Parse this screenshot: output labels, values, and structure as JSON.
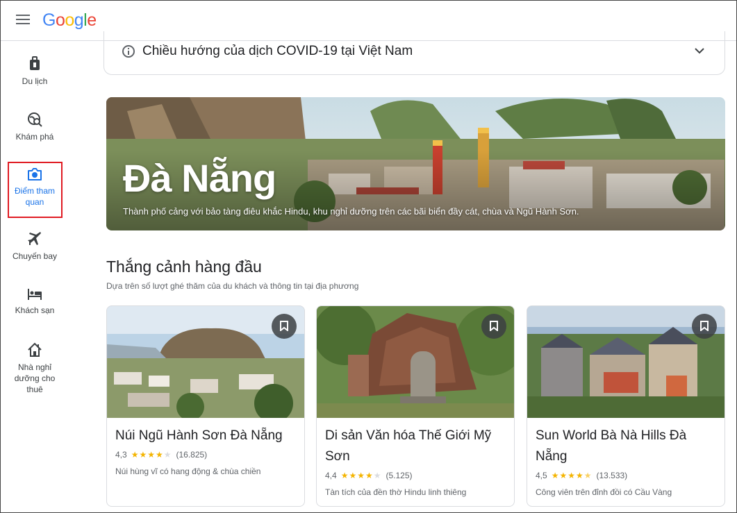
{
  "header": {
    "logo": [
      "G",
      "o",
      "o",
      "g",
      "l",
      "e"
    ],
    "logo_colors": [
      "#4285F4",
      "#EA4335",
      "#FBBC05",
      "#4285F4",
      "#34A853",
      "#EA4335"
    ]
  },
  "sidebar": {
    "items": [
      {
        "label": "Du lịch",
        "icon": "luggage-icon"
      },
      {
        "label": "Khám phá",
        "icon": "explore-search-icon"
      },
      {
        "label": "Điểm tham quan",
        "icon": "camera-icon",
        "active": true
      },
      {
        "label": "Chuyến bay",
        "icon": "airplane-icon"
      },
      {
        "label": "Khách sạn",
        "icon": "bed-icon"
      },
      {
        "label": "Nhà nghỉ dưỡng cho thuê",
        "icon": "house-icon"
      }
    ],
    "active_color": "#1a73e8",
    "highlight_color": "#e01a22"
  },
  "covid": {
    "text": "Chiều hướng của dịch COVID-19 tại Việt Nam",
    "icon": "info-icon",
    "expand_icon": "chevron-down-icon"
  },
  "hero": {
    "title": "Đà Nẵng",
    "subtitle": "Thành phố cảng với bảo tàng điêu khắc Hindu, khu nghỉ dưỡng trên các bãi biển đầy cát, chùa và Ngũ Hành Sơn."
  },
  "section": {
    "title": "Thắng cảnh hàng đầu",
    "subtitle": "Dựa trên số lượt ghé thăm của du khách và thông tin tại địa phương"
  },
  "cards": [
    {
      "title": "Núi Ngũ Hành Sơn Đà Nẵng",
      "rating": "4,3",
      "stars": 4.3,
      "reviews": "(16.825)",
      "description": "Núi hùng vĩ có hang động & chùa chiền"
    },
    {
      "title": "Di sản Văn hóa Thế Giới Mỹ Sơn",
      "rating": "4,4",
      "stars": 4.4,
      "reviews": "(5.125)",
      "description": "Tàn tích của đền thờ Hindu linh thiêng"
    },
    {
      "title": "Sun World Bà Nà Hills Đà Nẵng",
      "rating": "4,5",
      "stars": 4.5,
      "reviews": "(13.533)",
      "description": "Công viên trên đỉnh đồi có Cầu Vàng"
    }
  ]
}
